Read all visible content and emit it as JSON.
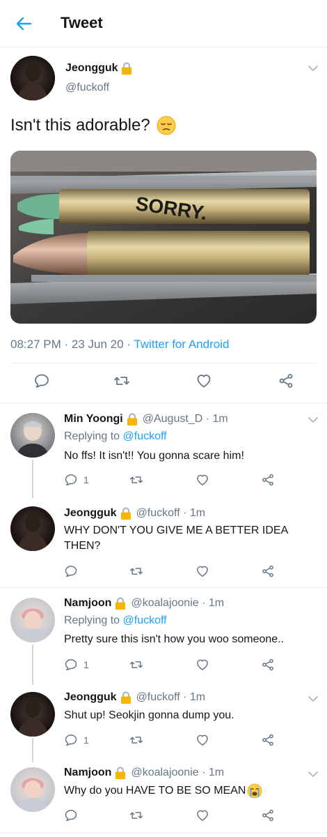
{
  "header": {
    "title": "Tweet"
  },
  "main_tweet": {
    "name": "Jeongguk",
    "handle": "@fuckoff",
    "text": "Isn't this adorable?",
    "media_caption": "SORRY.",
    "time": "08:27 PM",
    "date": "23 Jun 20",
    "source": "Twitter for Android",
    "sep": "·"
  },
  "replies": [
    {
      "name": "Min Yoongi",
      "handle": "@August_D · 1m",
      "replying_prefix": "Replying to ",
      "replying_to": "@fuckoff",
      "text": "No ffs! It isn't!! You gonna scare him!",
      "reply_count": "1"
    },
    {
      "name": "Jeongguk",
      "handle": "@fuckoff · 1m",
      "text": "WHY DON'T YOU GIVE ME A BETTER IDEA THEN?",
      "reply_count": ""
    },
    {
      "name": "Namjoon",
      "handle": "@koalajoonie · 1m",
      "replying_prefix": "Replying to ",
      "replying_to": "@fuckoff",
      "text": "Pretty sure this isn't how you woo someone..",
      "reply_count": "1"
    },
    {
      "name": "Jeongguk",
      "handle": "@fuckoff · 1m",
      "text": "Shut up! Seokjin gonna dump you.",
      "reply_count": "1"
    },
    {
      "name": "Namjoon",
      "handle": "@koalajoonie · 1m",
      "text": "Why do you HAVE TO BE SO MEAN",
      "reply_count": ""
    }
  ],
  "icons": {
    "back": "back-arrow-icon",
    "reply": "reply-icon",
    "retweet": "retweet-icon",
    "like": "heart-icon",
    "share": "share-icon",
    "lock": "lock-icon",
    "more": "chevron-down-icon"
  },
  "colors": {
    "accent": "#1da1f2",
    "secondary_text": "#657786",
    "divider": "#e6ecf0"
  }
}
